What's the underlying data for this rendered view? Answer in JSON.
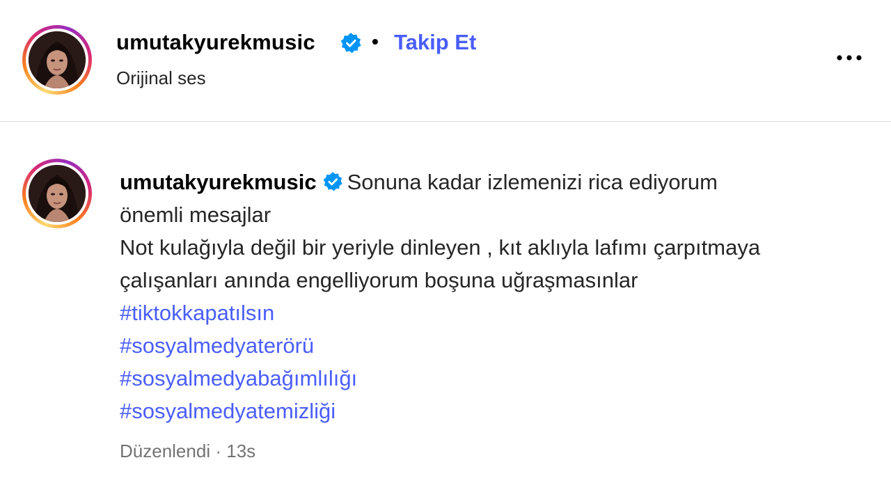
{
  "post_header": {
    "username": "umutakyurekmusic",
    "verified_icon": "verified-badge-icon",
    "separator": "•",
    "follow_label": "Takip Et",
    "audio_label": "Orijinal ses",
    "more_icon": "more-options-icon"
  },
  "comment": {
    "username": "umutakyurekmusic",
    "verified_icon": "verified-badge-icon",
    "line1": "Sonuna kadar izlemenizi rica ediyorum",
    "line2": "önemli mesajlar",
    "line3": "Not kulağıyla değil bir yeriyle dinleyen , kıt aklıyla lafımı çarpıtmaya",
    "line4": "çalışanları anında engelliyorum boşuna uğraşmasınlar",
    "hashtags": [
      "#tiktokkapatılsın",
      "#sosyalmedyaterörü",
      "#sosyalmedyabağımlılığı",
      "#sosyalmedyatemizliği"
    ],
    "edited_label": "Düzenlendi",
    "meta_separator": "·",
    "time_ago": "13s"
  },
  "colors": {
    "link_blue": "#4a5df9",
    "verified_blue": "#0095f6",
    "text_primary": "#000000",
    "text_secondary": "#737373",
    "divider": "#dbdbdb"
  }
}
